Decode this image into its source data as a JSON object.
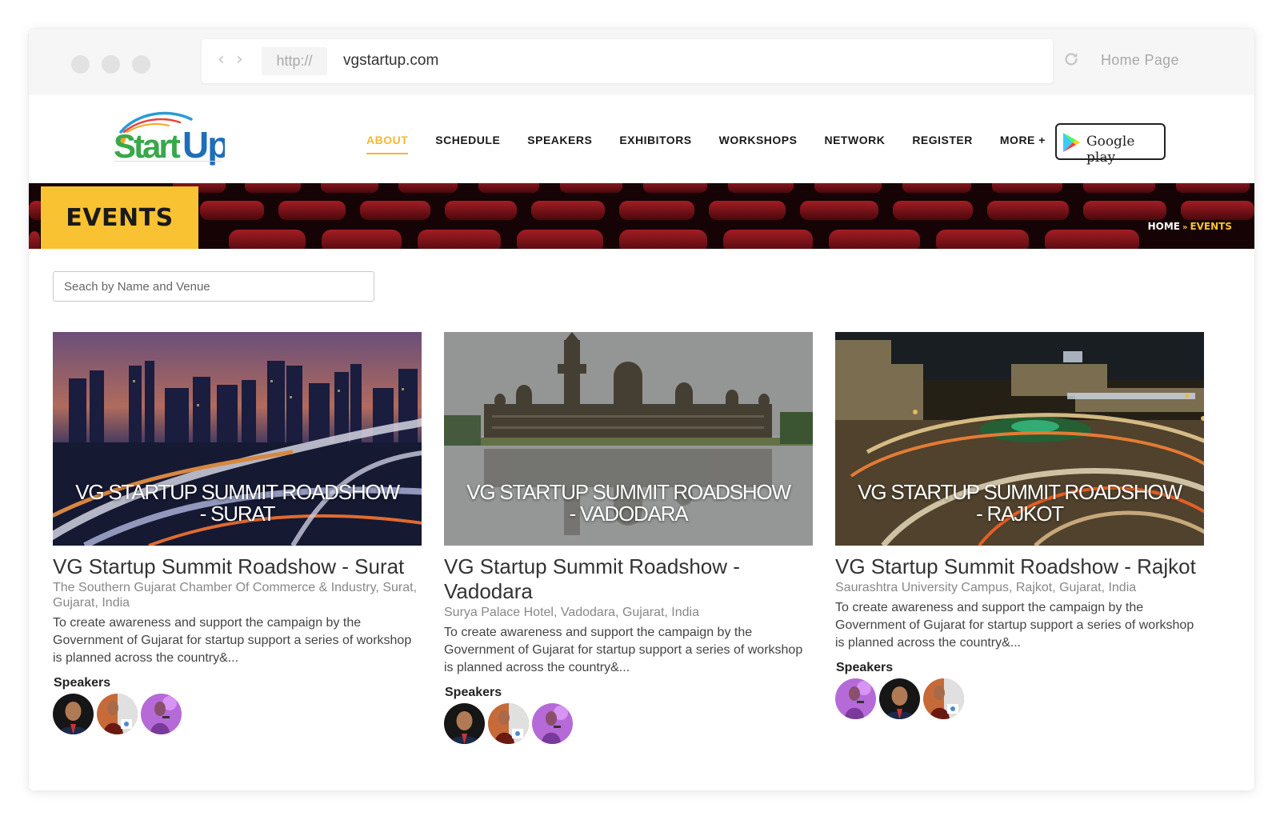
{
  "browser": {
    "protocol": "http://",
    "url": "vgstartup.com",
    "home_label": "Home Page"
  },
  "nav": {
    "items": [
      {
        "label": "ABOUT",
        "active": true
      },
      {
        "label": "SCHEDULE"
      },
      {
        "label": "SPEAKERS"
      },
      {
        "label": "EXHIBITORS"
      },
      {
        "label": "WORKSHOPS"
      },
      {
        "label": "NETWORK"
      },
      {
        "label": "REGISTER"
      },
      {
        "label": "MORE +"
      }
    ],
    "google_play_label": "Google play"
  },
  "banner": {
    "title": "EVENTS",
    "breadcrumb": {
      "home": "HOME",
      "separator": "»",
      "current": "EVENTS"
    }
  },
  "search": {
    "placeholder": "Seach by Name and Venue",
    "value": ""
  },
  "events": [
    {
      "image_caption_line1": "VG STARTUP SUMMIT ROADSHOW",
      "image_caption_line2": "- SURAT",
      "title": "VG Startup Summit Roadshow - Surat",
      "venue": "The Southern Gujarat Chamber Of Commerce & Industry, Surat, Gujarat, India",
      "description": "To create awareness and support the campaign by the Government of Gujarat for startup support a series of workshop is planned across the country&...",
      "speakers_label": "Speakers"
    },
    {
      "image_caption_line1": "VG STARTUP SUMMIT ROADSHOW",
      "image_caption_line2": "- VADODARA",
      "title": "VG Startup Summit Roadshow - Vadodara",
      "venue": "Surya Palace Hotel, Vadodara, Gujarat, India",
      "description": "To create awareness and support the campaign by the Government of Gujarat for startup support a series of workshop is planned across the country&...",
      "speakers_label": "Speakers"
    },
    {
      "image_caption_line1": "VG STARTUP SUMMIT ROADSHOW",
      "image_caption_line2": "- RAJKOT",
      "title": "VG Startup Summit Roadshow - Rajkot",
      "venue": "Saurashtra University Campus, Rajkot, Gujarat, India",
      "description": "To create awareness and support the campaign by the Government of Gujarat for startup support a series of workshop is planned across the country&...",
      "speakers_label": "Speakers"
    }
  ],
  "colors": {
    "accent": "#f9c232",
    "nav_active": "#f5b82e",
    "text_dark": "#333333",
    "text_muted": "#888888"
  },
  "icons": [
    "back-arrow-icon",
    "forward-arrow-icon",
    "reload-icon",
    "google-play-icon",
    "startup-logo"
  ]
}
